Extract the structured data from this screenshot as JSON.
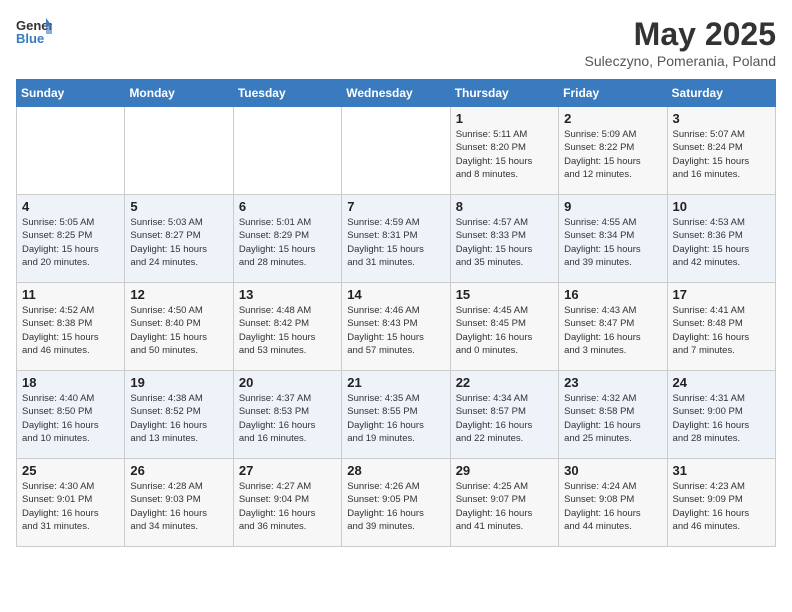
{
  "header": {
    "logo_general": "General",
    "logo_blue": "Blue",
    "title": "May 2025",
    "subtitle": "Suleczyno, Pomerania, Poland"
  },
  "days_of_week": [
    "Sunday",
    "Monday",
    "Tuesday",
    "Wednesday",
    "Thursday",
    "Friday",
    "Saturday"
  ],
  "weeks": [
    [
      {
        "day": "",
        "info": ""
      },
      {
        "day": "",
        "info": ""
      },
      {
        "day": "",
        "info": ""
      },
      {
        "day": "",
        "info": ""
      },
      {
        "day": "1",
        "info": "Sunrise: 5:11 AM\nSunset: 8:20 PM\nDaylight: 15 hours\nand 8 minutes."
      },
      {
        "day": "2",
        "info": "Sunrise: 5:09 AM\nSunset: 8:22 PM\nDaylight: 15 hours\nand 12 minutes."
      },
      {
        "day": "3",
        "info": "Sunrise: 5:07 AM\nSunset: 8:24 PM\nDaylight: 15 hours\nand 16 minutes."
      }
    ],
    [
      {
        "day": "4",
        "info": "Sunrise: 5:05 AM\nSunset: 8:25 PM\nDaylight: 15 hours\nand 20 minutes."
      },
      {
        "day": "5",
        "info": "Sunrise: 5:03 AM\nSunset: 8:27 PM\nDaylight: 15 hours\nand 24 minutes."
      },
      {
        "day": "6",
        "info": "Sunrise: 5:01 AM\nSunset: 8:29 PM\nDaylight: 15 hours\nand 28 minutes."
      },
      {
        "day": "7",
        "info": "Sunrise: 4:59 AM\nSunset: 8:31 PM\nDaylight: 15 hours\nand 31 minutes."
      },
      {
        "day": "8",
        "info": "Sunrise: 4:57 AM\nSunset: 8:33 PM\nDaylight: 15 hours\nand 35 minutes."
      },
      {
        "day": "9",
        "info": "Sunrise: 4:55 AM\nSunset: 8:34 PM\nDaylight: 15 hours\nand 39 minutes."
      },
      {
        "day": "10",
        "info": "Sunrise: 4:53 AM\nSunset: 8:36 PM\nDaylight: 15 hours\nand 42 minutes."
      }
    ],
    [
      {
        "day": "11",
        "info": "Sunrise: 4:52 AM\nSunset: 8:38 PM\nDaylight: 15 hours\nand 46 minutes."
      },
      {
        "day": "12",
        "info": "Sunrise: 4:50 AM\nSunset: 8:40 PM\nDaylight: 15 hours\nand 50 minutes."
      },
      {
        "day": "13",
        "info": "Sunrise: 4:48 AM\nSunset: 8:42 PM\nDaylight: 15 hours\nand 53 minutes."
      },
      {
        "day": "14",
        "info": "Sunrise: 4:46 AM\nSunset: 8:43 PM\nDaylight: 15 hours\nand 57 minutes."
      },
      {
        "day": "15",
        "info": "Sunrise: 4:45 AM\nSunset: 8:45 PM\nDaylight: 16 hours\nand 0 minutes."
      },
      {
        "day": "16",
        "info": "Sunrise: 4:43 AM\nSunset: 8:47 PM\nDaylight: 16 hours\nand 3 minutes."
      },
      {
        "day": "17",
        "info": "Sunrise: 4:41 AM\nSunset: 8:48 PM\nDaylight: 16 hours\nand 7 minutes."
      }
    ],
    [
      {
        "day": "18",
        "info": "Sunrise: 4:40 AM\nSunset: 8:50 PM\nDaylight: 16 hours\nand 10 minutes."
      },
      {
        "day": "19",
        "info": "Sunrise: 4:38 AM\nSunset: 8:52 PM\nDaylight: 16 hours\nand 13 minutes."
      },
      {
        "day": "20",
        "info": "Sunrise: 4:37 AM\nSunset: 8:53 PM\nDaylight: 16 hours\nand 16 minutes."
      },
      {
        "day": "21",
        "info": "Sunrise: 4:35 AM\nSunset: 8:55 PM\nDaylight: 16 hours\nand 19 minutes."
      },
      {
        "day": "22",
        "info": "Sunrise: 4:34 AM\nSunset: 8:57 PM\nDaylight: 16 hours\nand 22 minutes."
      },
      {
        "day": "23",
        "info": "Sunrise: 4:32 AM\nSunset: 8:58 PM\nDaylight: 16 hours\nand 25 minutes."
      },
      {
        "day": "24",
        "info": "Sunrise: 4:31 AM\nSunset: 9:00 PM\nDaylight: 16 hours\nand 28 minutes."
      }
    ],
    [
      {
        "day": "25",
        "info": "Sunrise: 4:30 AM\nSunset: 9:01 PM\nDaylight: 16 hours\nand 31 minutes."
      },
      {
        "day": "26",
        "info": "Sunrise: 4:28 AM\nSunset: 9:03 PM\nDaylight: 16 hours\nand 34 minutes."
      },
      {
        "day": "27",
        "info": "Sunrise: 4:27 AM\nSunset: 9:04 PM\nDaylight: 16 hours\nand 36 minutes."
      },
      {
        "day": "28",
        "info": "Sunrise: 4:26 AM\nSunset: 9:05 PM\nDaylight: 16 hours\nand 39 minutes."
      },
      {
        "day": "29",
        "info": "Sunrise: 4:25 AM\nSunset: 9:07 PM\nDaylight: 16 hours\nand 41 minutes."
      },
      {
        "day": "30",
        "info": "Sunrise: 4:24 AM\nSunset: 9:08 PM\nDaylight: 16 hours\nand 44 minutes."
      },
      {
        "day": "31",
        "info": "Sunrise: 4:23 AM\nSunset: 9:09 PM\nDaylight: 16 hours\nand 46 minutes."
      }
    ]
  ]
}
